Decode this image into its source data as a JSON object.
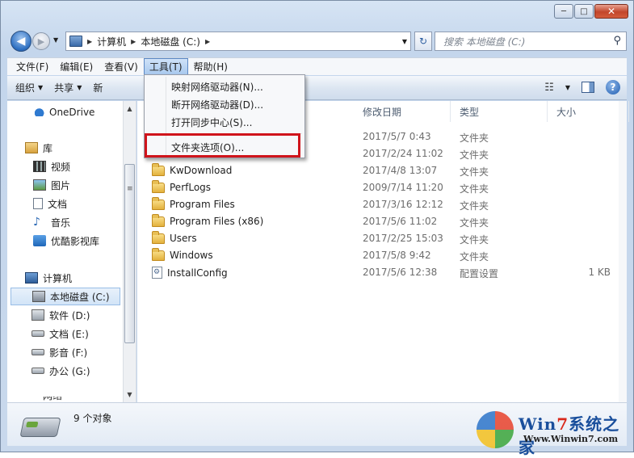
{
  "window": {
    "caption": {
      "minimize": "─",
      "maximize": "□",
      "close": "✕"
    }
  },
  "nav": {
    "back_glyph": "◀",
    "forward_glyph": "▶",
    "history_glyph": "▼",
    "breadcrumb": [
      "计算机",
      "本地磁盘 (C:)"
    ],
    "refresh_glyph": "↻",
    "search_placeholder": "搜索 本地磁盘 (C:)",
    "search_icon": "search-icon"
  },
  "menubar": {
    "items": [
      "文件(F)",
      "编辑(E)",
      "查看(V)",
      "工具(T)",
      "帮助(H)"
    ],
    "active": "工具(T)"
  },
  "toolbar": {
    "organize": "组织",
    "share": "共享",
    "new_folder_partial": "新",
    "view_glyph": "☷",
    "help_glyph": "?"
  },
  "tools_menu": {
    "items": [
      "映射网络驱动器(N)...",
      "断开网络驱动器(D)...",
      "打开同步中心(S)...",
      "文件夹选项(O)..."
    ],
    "highlighted": "文件夹选项(O)..."
  },
  "sidebar": {
    "onedrive": "OneDrive",
    "libraries": "库",
    "library_items": [
      "视频",
      "图片",
      "文档",
      "音乐",
      "优酷影视库"
    ],
    "computer": "计算机",
    "drives": [
      "本地磁盘 (C:)",
      "软件 (D:)",
      "文档 (E:)",
      "影音 (F:)",
      "办公 (G:)"
    ],
    "selected": "本地磁盘 (C:)",
    "network_partial": "网络"
  },
  "columns": {
    "date": "修改日期",
    "type": "类型",
    "size": "大小"
  },
  "files": [
    {
      "name": "",
      "date": "2017/5/7 0:43",
      "type": "文件夹",
      "size": ""
    },
    {
      "name": "",
      "date": "2017/2/24 11:02",
      "type": "文件夹",
      "size": ""
    },
    {
      "name": "KwDownload",
      "date": "2017/4/8 13:07",
      "type": "文件夹",
      "size": ""
    },
    {
      "name": "PerfLogs",
      "date": "2009/7/14 11:20",
      "type": "文件夹",
      "size": ""
    },
    {
      "name": "Program Files",
      "date": "2017/3/16 12:12",
      "type": "文件夹",
      "size": ""
    },
    {
      "name": "Program Files (x86)",
      "date": "2017/5/6 11:02",
      "type": "文件夹",
      "size": ""
    },
    {
      "name": "Users",
      "date": "2017/2/25 15:03",
      "type": "文件夹",
      "size": ""
    },
    {
      "name": "Windows",
      "date": "2017/5/8 9:42",
      "type": "文件夹",
      "size": ""
    },
    {
      "name": "InstallConfig",
      "date": "2017/5/6 12:38",
      "type": "配置设置",
      "size": "1 KB"
    }
  ],
  "status": {
    "item_count": "9 个对象"
  },
  "watermark": {
    "title_a": "Win",
    "title_b": "7",
    "title_c": "系统之家",
    "url": "Www.Winwin7.com"
  }
}
